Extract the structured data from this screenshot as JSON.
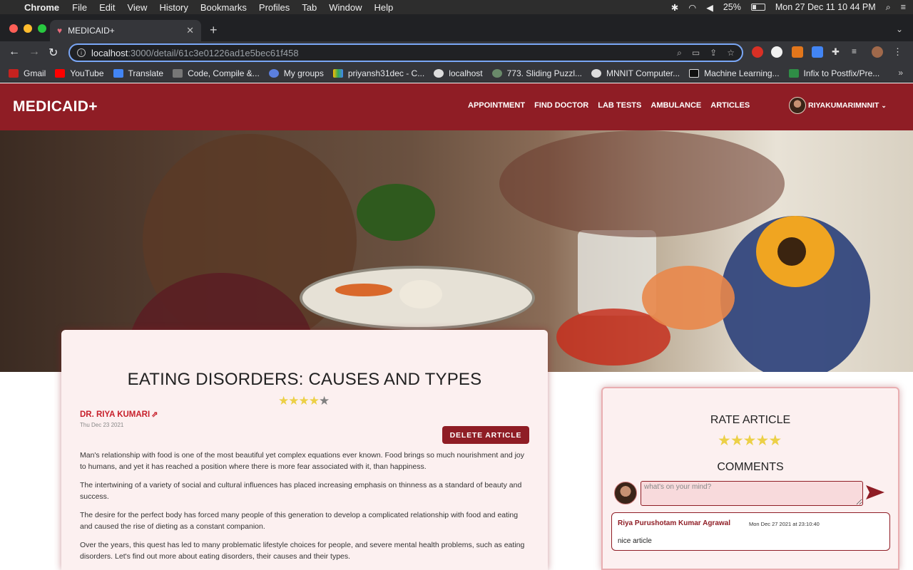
{
  "macos": {
    "app": "Chrome",
    "menu": [
      "File",
      "Edit",
      "View",
      "History",
      "Bookmarks",
      "Profiles",
      "Tab",
      "Window",
      "Help"
    ],
    "battery": "25%",
    "datetime": "Mon 27 Dec  11 10 44 PM"
  },
  "browser": {
    "tab_title": "MEDICAID+",
    "url_host": "localhost",
    "url_path": ":3000/detail/61c3e01226ad1e5bec61f458",
    "bookmarks": [
      "Gmail",
      "YouTube",
      "Translate",
      "Code, Compile &...",
      "My groups",
      "priyansh31dec - C...",
      "localhost",
      "773. Sliding Puzzl...",
      "MNNIT Computer...",
      "Machine Learning...",
      "Infix to Postfix/Pre..."
    ]
  },
  "header": {
    "brand": "MEDICAID+",
    "nav": [
      "APPOINTMENT",
      "FIND DOCTOR",
      "LAB TESTS",
      "AMBULANCE",
      "ARTICLES"
    ],
    "username": "RIYAKUMARIMNNIT"
  },
  "article": {
    "title": "EATING DISORDERS: CAUSES AND TYPES",
    "rating": 4,
    "max_rating": 5,
    "author": "DR. RIYA KUMARI",
    "date": "Thu Dec 23 2021",
    "delete_label": "DELETE ARTICLE",
    "paragraphs": [
      "Man's relationship with food is one of the most beautiful yet complex equations ever known. Food brings so much nourishment and joy to humans, and yet it has reached a position where there is more fear associated with it, than happiness.",
      "The intertwining of a variety of social and cultural influences has placed increasing emphasis on thinness as a standard of beauty and success.",
      "The desire for the perfect body has forced many people of this generation to develop a complicated relationship with food and eating and caused the rise of dieting as a constant companion.",
      "Over the years, this quest has led to many problematic lifestyle choices for people, and severe mental health problems, such as eating disorders. Let's find out more about eating disorders, their causes and their types."
    ]
  },
  "panel": {
    "rate_title": "RATE ARTICLE",
    "rate_stars": 5,
    "comments_title": "COMMENTS",
    "comment_placeholder": "what's on your mind?",
    "comments": [
      {
        "name": "Riya Purushotam Kumar Agrawal",
        "date": "Mon Dec 27 2021 at 23:10:40",
        "text": "nice article"
      }
    ]
  },
  "colors": {
    "brand": "#8f1d25",
    "card": "#fcf0f0",
    "star": "#ecd047"
  }
}
